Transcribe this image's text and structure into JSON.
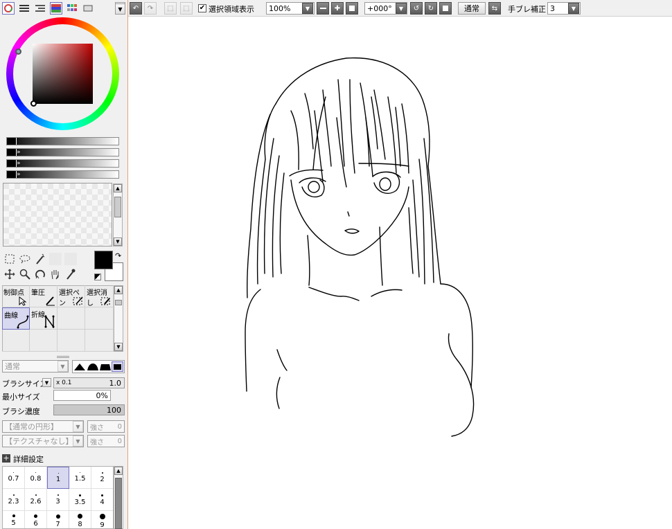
{
  "toolbar": {
    "show_selection_label": "選択領域表示",
    "show_selection_checked": true,
    "zoom_value": "100%",
    "angle_value": "+000°",
    "blend_mode": "通常",
    "stabilizer_label": "手ブレ補正",
    "stabilizer_value": "3"
  },
  "tool_tabs": [
    {
      "label": "制御点"
    },
    {
      "label": "筆圧"
    },
    {
      "label": "選択ペン"
    },
    {
      "label": "選択消し"
    },
    {
      "label": "曲線"
    },
    {
      "label": "折線"
    }
  ],
  "brush": {
    "mode": "通常",
    "size_label": "ブラシサイズ",
    "size_multiplier": "x 0.1",
    "size_value": "1.0",
    "min_size_label": "最小サイズ",
    "min_size_value": "0%",
    "density_label": "ブラシ濃度",
    "density_value": "100",
    "shape_value": "【通常の円形】",
    "shape_strength_label": "強さ",
    "shape_strength_value": "0",
    "texture_value": "【テクスチャなし】",
    "texture_strength_label": "強さ",
    "texture_strength_value": "0",
    "advanced_label": "詳細設定"
  },
  "sizes": [
    "0.7",
    "0.8",
    "1",
    "1.5",
    "2",
    "2.3",
    "2.6",
    "3",
    "3.5",
    "4",
    "5",
    "6",
    "7",
    "8",
    "9"
  ],
  "selected_size": "1",
  "colors": {
    "primary": "#000000",
    "secondary": "#ffffff",
    "accent_border": "#e2a27a",
    "selection": "#d8d8f0"
  }
}
